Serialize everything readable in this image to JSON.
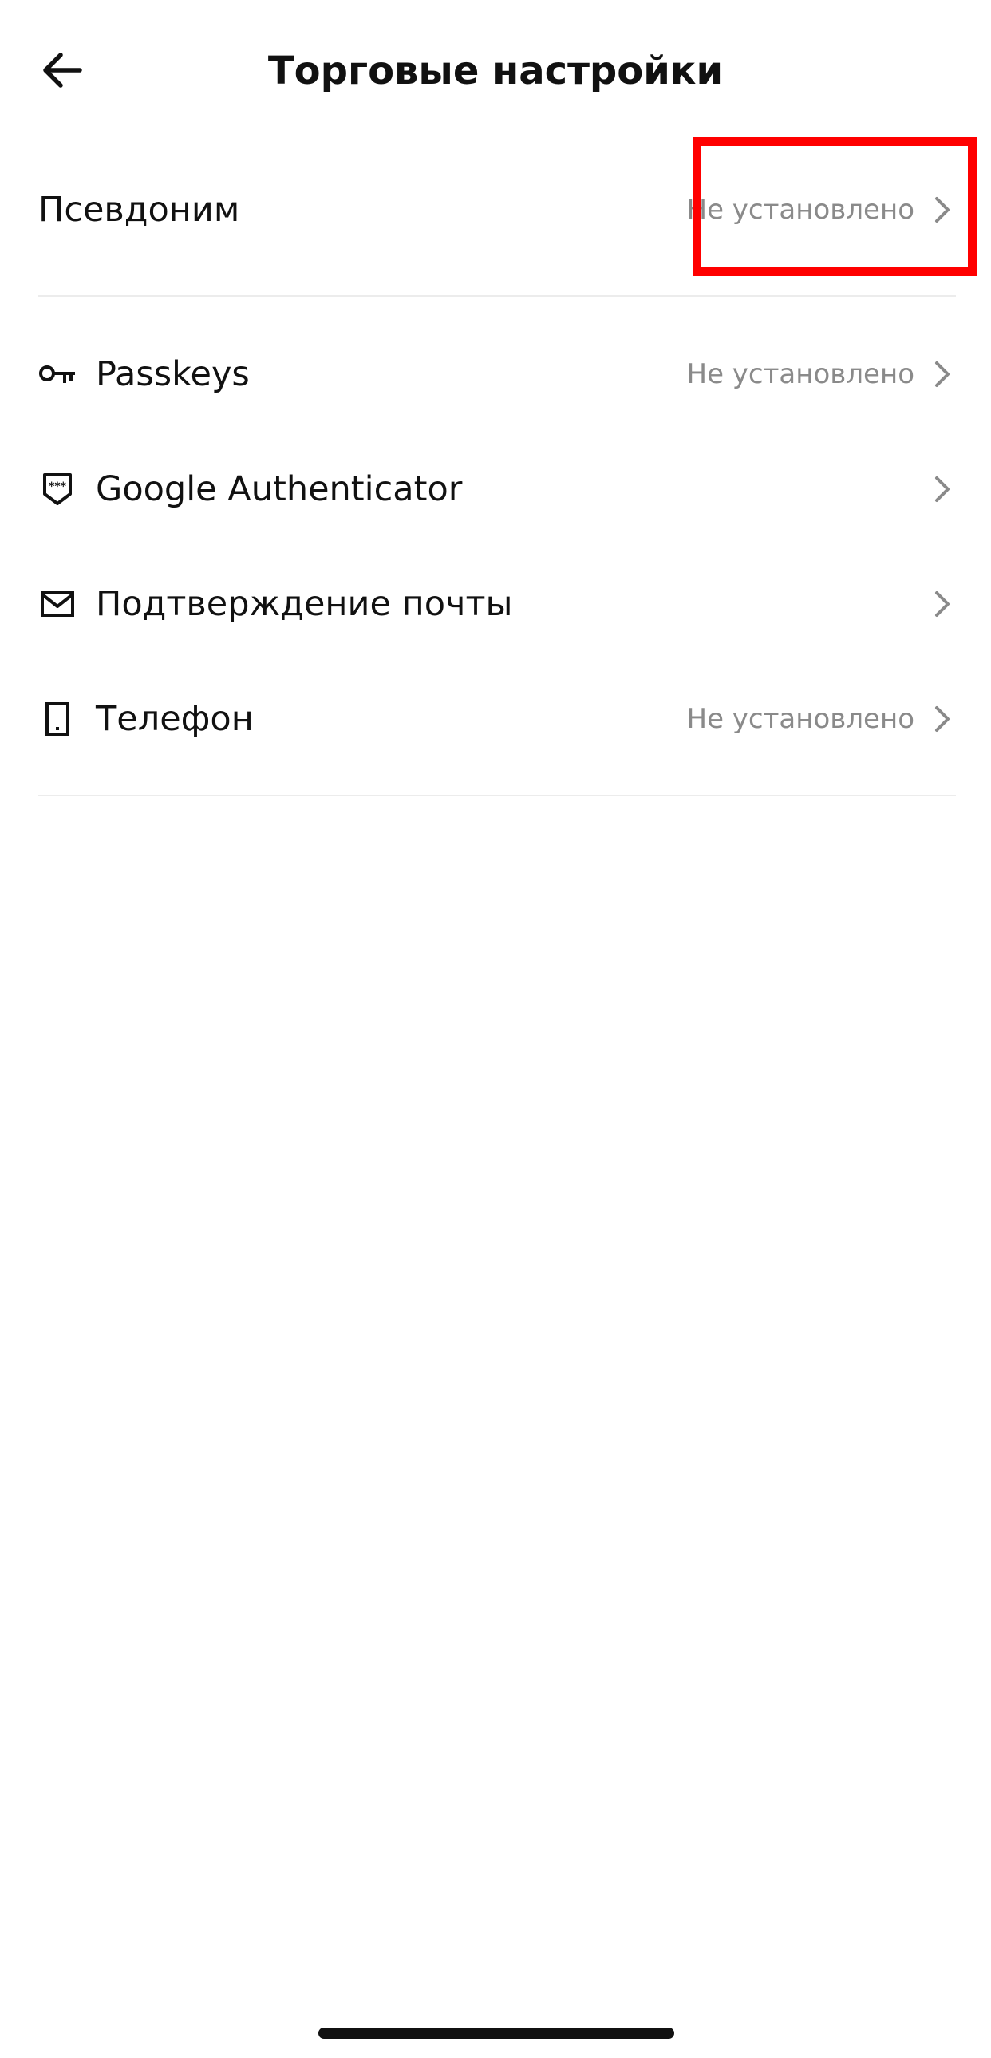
{
  "header": {
    "title": "Торговые настройки"
  },
  "rows": {
    "nickname": {
      "label": "Псевдоним",
      "value": "Не установлено"
    },
    "passkeys": {
      "label": "Passkeys",
      "value": "Не установлено",
      "icon": "key-icon"
    },
    "google_auth": {
      "label": "Google Authenticator",
      "icon": "shield-password-icon"
    },
    "email_confirm": {
      "label": "Подтверждение почты",
      "icon": "envelope-icon"
    },
    "phone": {
      "label": "Телефон",
      "value": "Не установлено",
      "icon": "phone-icon"
    }
  },
  "colors": {
    "highlight": "#ff0000",
    "secondary_text": "#8a8a8a",
    "divider": "#ececec"
  }
}
